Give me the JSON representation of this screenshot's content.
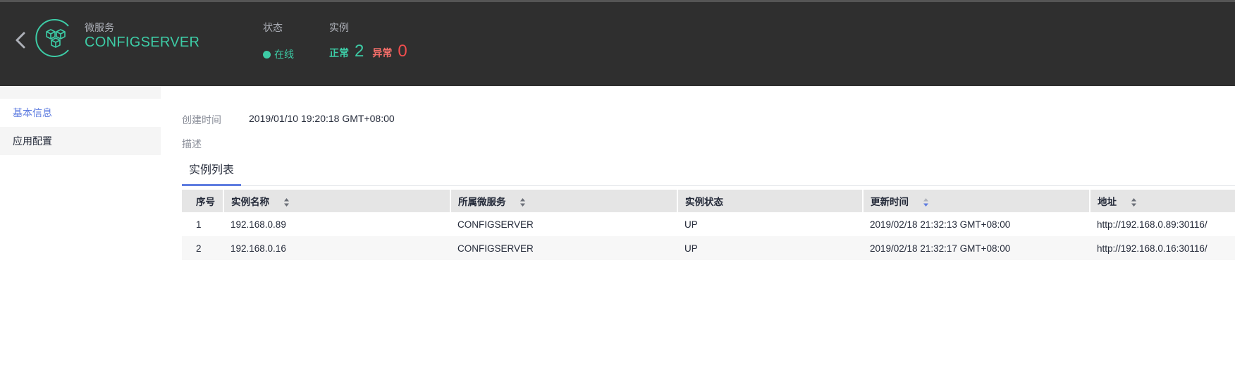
{
  "header": {
    "service_caption": "微服务",
    "service_name": "CONFIGSERVER",
    "status_caption": "状态",
    "status_value": "在线",
    "instance_caption": "实例",
    "normal_label": "正常",
    "normal_count": "2",
    "abnormal_label": "异常",
    "abnormal_count": "0"
  },
  "sidebar": {
    "items": [
      {
        "label": "基本信息",
        "active": true
      },
      {
        "label": "应用配置",
        "active": false
      }
    ]
  },
  "info": {
    "created_label": "创建时间",
    "created_value": "2019/01/10 19:20:18 GMT+08:00",
    "description_label": "描述",
    "description_value": ""
  },
  "tabs": [
    {
      "label": "实例列表",
      "active": true
    }
  ],
  "table": {
    "columns": [
      "序号",
      "实例名称",
      "所属微服务",
      "实例状态",
      "更新时间",
      "地址"
    ],
    "rows": [
      [
        "1",
        "192.168.0.89",
        "CONFIGSERVER",
        "UP",
        "2019/02/18 21:32:13 GMT+08:00",
        "http://192.168.0.89:30116/"
      ],
      [
        "2",
        "192.168.0.16",
        "CONFIGSERVER",
        "UP",
        "2019/02/18 21:32:17 GMT+08:00",
        "http://192.168.0.16:30116/"
      ]
    ]
  },
  "colors": {
    "accent_green": "#3dcca6",
    "accent_red": "#f14d4d",
    "accent_blue": "#5e7ce0",
    "header_bg": "#2f2f2f"
  },
  "icons": {
    "back": "chevron-left-icon",
    "logo": "microservice-cubes-icon",
    "sort": "sort-icon",
    "sort_active": "sort-desc-icon"
  }
}
